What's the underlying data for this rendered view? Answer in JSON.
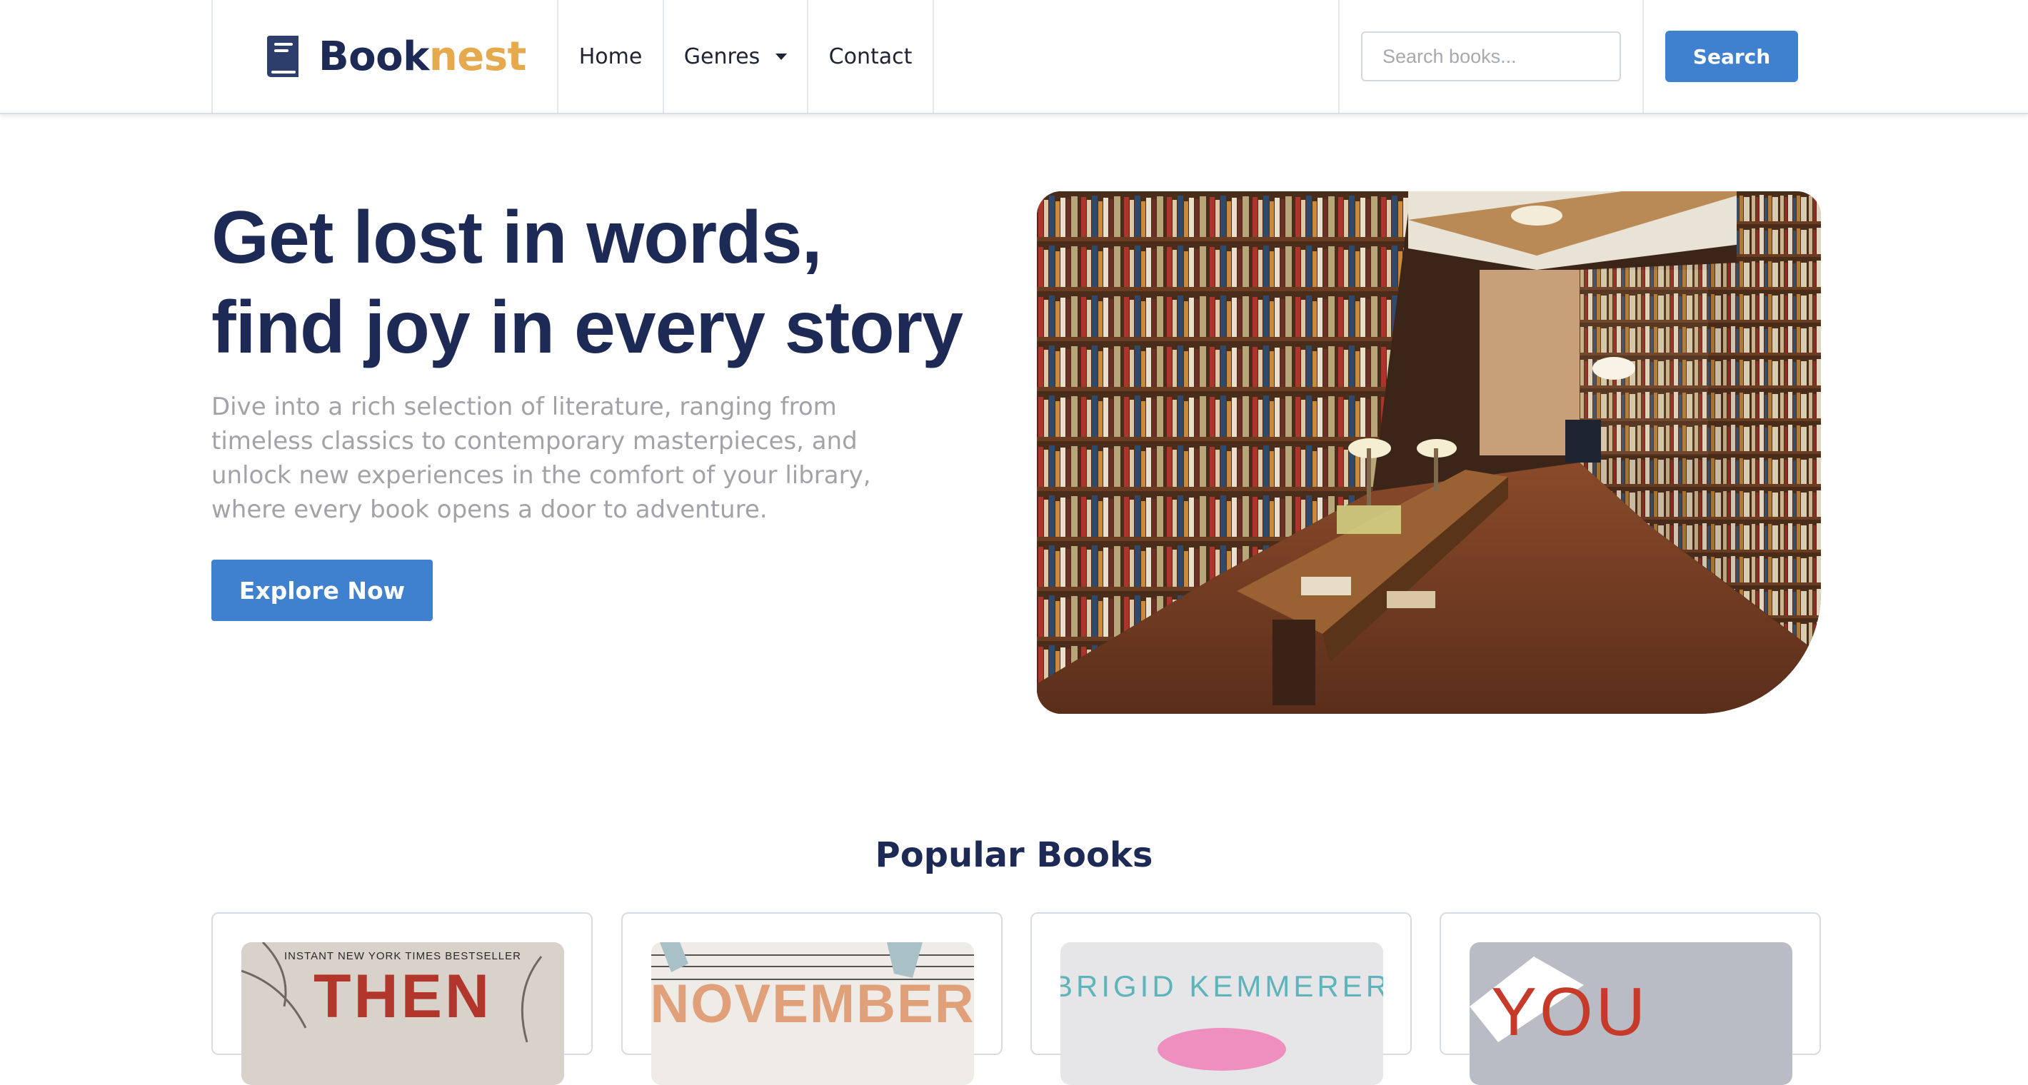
{
  "brand": {
    "name_part1": "Book",
    "name_part2": "nest",
    "icon": "book-icon",
    "colors": {
      "navy": "#1c2a55",
      "accent": "#e7a94d",
      "primary": "#3f80cf"
    }
  },
  "nav": {
    "items": [
      {
        "label": "Home"
      },
      {
        "label": "Genres",
        "icon": "caret-down-icon"
      },
      {
        "label": "Contact"
      }
    ],
    "search": {
      "placeholder": "Search books...",
      "value": "",
      "button_label": "Search"
    }
  },
  "hero": {
    "title_line1": "Get lost in words,",
    "title_line2": "find joy in every story",
    "description": "Dive into a rich selection of literature, ranging from timeless classics to contemporary masterpieces, and unlock new experiences in the comfort of your library, where every book opens a door to adventure.",
    "cta_label": "Explore Now",
    "image_subject": "library-room-photo"
  },
  "popular": {
    "title": "Popular Books",
    "books": [
      {
        "cover_top_text": "INSTANT NEW YORK TIMES BESTSELLER",
        "cover_title": "THEN"
      },
      {
        "cover_title": "NOVEMBER"
      },
      {
        "cover_top_text": "BRIGID KEMMERER"
      },
      {
        "cover_title": "YOU"
      }
    ]
  }
}
